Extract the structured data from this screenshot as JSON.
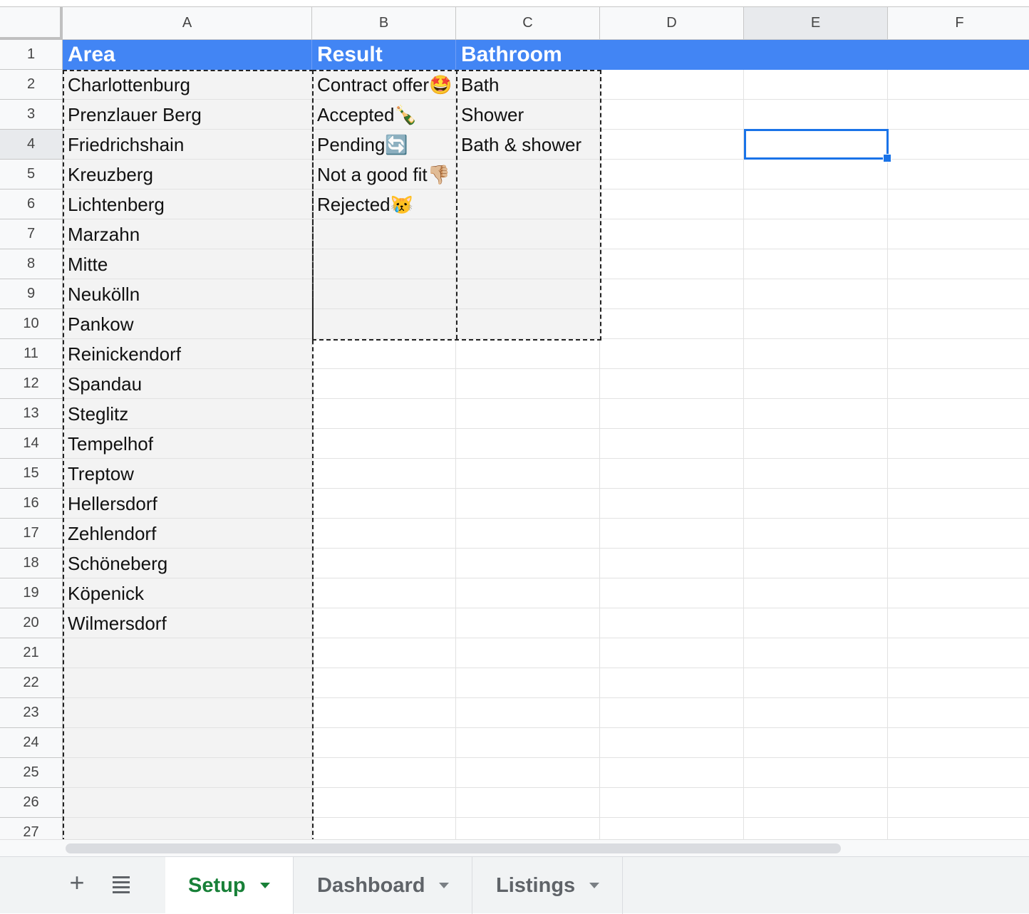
{
  "columns": [
    "A",
    "B",
    "C",
    "D",
    "E",
    "F"
  ],
  "rows": [
    "1",
    "2",
    "3",
    "4",
    "5",
    "6",
    "7",
    "8",
    "9",
    "10",
    "11",
    "12",
    "13",
    "14",
    "15",
    "16",
    "17",
    "18",
    "19",
    "20",
    "21",
    "22",
    "23",
    "24",
    "25",
    "26",
    "27"
  ],
  "cells": {
    "A1": "Area",
    "B1": "Result",
    "C1": "Bathroom",
    "A2": "Charlottenburg",
    "B2": "Contract offer🤩",
    "C2": "Bath",
    "A3": "Prenzlauer Berg",
    "B3": "Accepted🍾",
    "C3": "Shower",
    "A4": "Friedrichshain",
    "B4": "Pending🔄",
    "C4": "Bath & shower",
    "A5": "Kreuzberg",
    "B5": "Not a good fit👎🏼",
    "A6": "Lichtenberg",
    "B6": "Rejected😿",
    "A7": "Marzahn",
    "A8": "Mitte",
    "A9": "Neukölln",
    "A10": "Pankow",
    "A11": "Reinickendorf",
    "A12": "Spandau",
    "A13": "Steglitz",
    "A14": "Tempelhof",
    "A15": "Treptow",
    "A16": "Hellersdorf",
    "A17": "Zehlendorf",
    "A18": "Schöneberg",
    "A19": "Köpenick",
    "A20": "Wilmersdorf"
  },
  "active_cell": "E4",
  "sheet_tabs": [
    {
      "label": "Setup",
      "active": true
    },
    {
      "label": "Dashboard",
      "active": false
    },
    {
      "label": "Listings",
      "active": false
    }
  ],
  "icons": {
    "add_sheet": "plus-icon",
    "all_sheets": "list-icon",
    "tab_menu": "caret-down-icon"
  },
  "colors": {
    "header_fill": "#4285f4",
    "active_tab": "#188038",
    "selection": "#1a73e8",
    "shaded": "#f3f3f3"
  }
}
